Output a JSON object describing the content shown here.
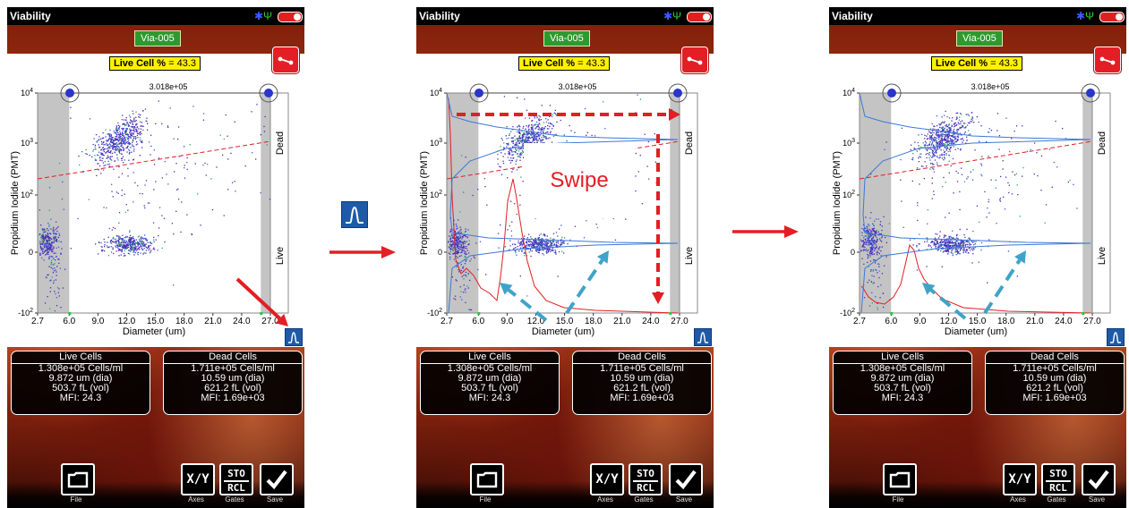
{
  "colors": {
    "accent_red": "#e31e24",
    "badge_green": "#2e9a2e",
    "live_badge_yellow": "#fff200",
    "hist_blue": "#3c78d8",
    "gate_blue": "#2a35c9",
    "swipe_teal": "#3fa3c9"
  },
  "screens": [
    {
      "status_title": "Viability",
      "sample_name": "Via-005",
      "live_label": "Live Cell %",
      "live_eq": " = 43.3",
      "gate_count": "3.018e+05",
      "y_axis_label": "Propidium Iodide (PMT)",
      "x_axis_label": "Diameter (um)",
      "region_top": "Dead",
      "region_bottom": "Live",
      "y_ticks": [
        "10^4",
        "10^3",
        "10^2",
        "0",
        "-10^2"
      ],
      "x_ticks": [
        "2.7",
        "6.0",
        "9.0",
        "12.0",
        "15.0",
        "18.0",
        "21.0",
        "24.0",
        "27.0"
      ],
      "live": {
        "title": "Live Cells",
        "conc": "1.308e+05 Cells/ml",
        "dia": "9.872 um (dia)",
        "vol": "503.7 fL (vol)",
        "mfi": "MFI:  24.3"
      },
      "dead": {
        "title": "Dead Cells",
        "conc": "1.711e+05 Cells/ml",
        "dia": "10.59 um (dia)",
        "vol": "621.2 fL (vol)",
        "mfi": "MFI: 1.69e+03"
      },
      "toolbar": {
        "xy_label": "X/Y",
        "sto_label": "STO",
        "rcl_label": "RCL",
        "file_label": "File",
        "axes_label": "Axes",
        "gates_label": "Gates",
        "save_label": "Save"
      }
    }
  ],
  "annotation": {
    "swipe_label": "Swipe"
  },
  "icons": {
    "bluetooth": "bluetooth-icon",
    "usb": "usb-icon",
    "battery": "battery-icon",
    "gate": "gate-icon",
    "histogram": "histogram-icon",
    "folder": "folder-icon",
    "checkmark": "checkmark-icon"
  }
}
